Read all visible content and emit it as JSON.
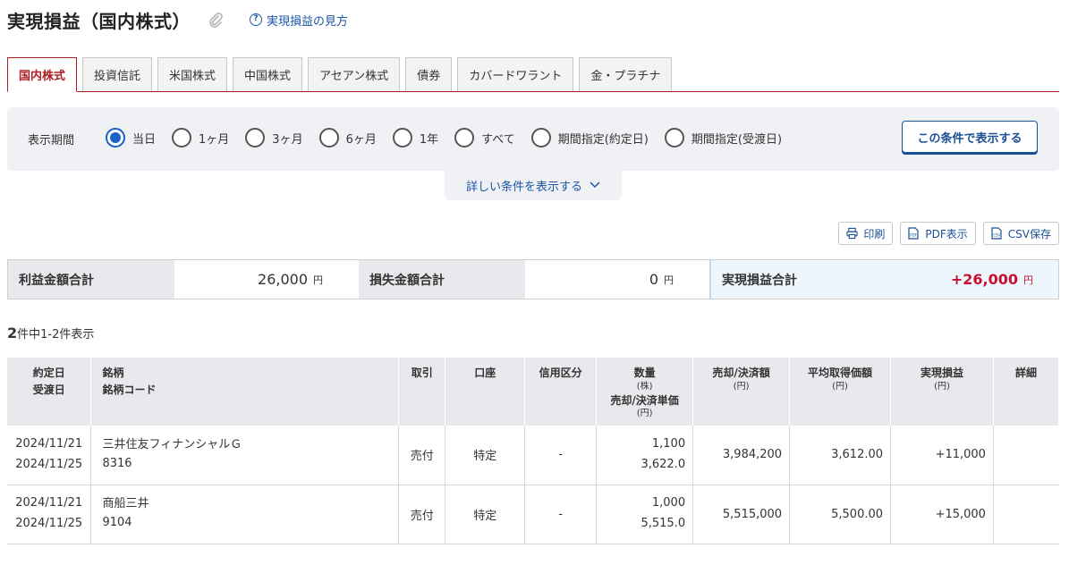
{
  "header": {
    "title": "実現損益（国内株式）",
    "help_link": "実現損益の見方"
  },
  "tabs": [
    "国内株式",
    "投資信託",
    "米国株式",
    "中国株式",
    "アセアン株式",
    "債券",
    "カバードワラント",
    "金・プラチナ"
  ],
  "filter": {
    "period_label": "表示期間",
    "options": [
      "当日",
      "1ヶ月",
      "3ヶ月",
      "6ヶ月",
      "1年",
      "すべて",
      "期間指定(約定日)",
      "期間指定(受渡日)"
    ],
    "selected": "当日",
    "apply_button": "この条件で表示する",
    "more_conditions": "詳しい条件を表示する"
  },
  "toolbar": {
    "print": "印刷",
    "pdf": "PDF表示",
    "csv": "CSV保存"
  },
  "summary": {
    "profit_label": "利益金額合計",
    "profit_value": "26,000",
    "loss_label": "損失金額合計",
    "loss_value": "0",
    "total_label": "実現損益合計",
    "total_value": "+26,000",
    "unit": "円"
  },
  "result_count": {
    "num": "2",
    "text": "件中1-2件表示"
  },
  "table": {
    "headers": {
      "date1": "約定日",
      "date2": "受渡日",
      "name1": "銘柄",
      "name2": "銘柄コード",
      "trade": "取引",
      "account": "口座",
      "credit": "信用区分",
      "qty": "数量",
      "qty_unit": "(株)",
      "price": "売却/決済単価",
      "price_unit": "(円)",
      "amount": "売却/決済額",
      "amount_unit": "(円)",
      "avg": "平均取得価額",
      "avg_unit": "(円)",
      "pl": "実現損益",
      "pl_unit": "(円)",
      "detail": "詳細"
    },
    "rows": [
      {
        "trade_date": "2024/11/21",
        "settle_date": "2024/11/25",
        "name": "三井住友フィナンシャルＧ",
        "code": "8316",
        "trade": "売付",
        "account": "特定",
        "credit": "-",
        "qty": "1,100",
        "price": "3,622.0",
        "amount": "3,984,200",
        "avg": "3,612.00",
        "pl": "+11,000"
      },
      {
        "trade_date": "2024/11/21",
        "settle_date": "2024/11/25",
        "name": "商船三井",
        "code": "9104",
        "trade": "売付",
        "account": "特定",
        "credit": "-",
        "qty": "1,000",
        "price": "5,515.0",
        "amount": "5,515,000",
        "avg": "5,500.00",
        "pl": "+15,000"
      }
    ]
  },
  "colors": {
    "accent_red": "#b01e23",
    "link_blue": "#1a56a8",
    "profit_red": "#c8102e"
  }
}
